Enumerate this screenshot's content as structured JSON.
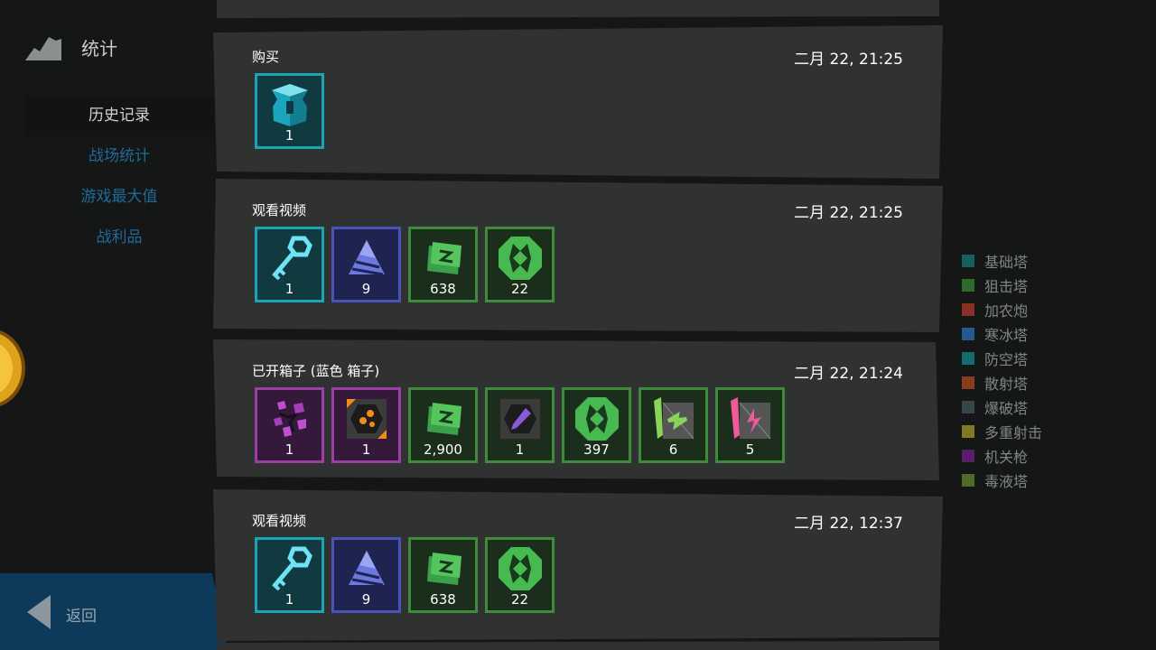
{
  "sidebar": {
    "title": "统计",
    "nav": [
      {
        "label": "历史记录",
        "active": true
      },
      {
        "label": "战场统计",
        "active": false
      },
      {
        "label": "游戏最大值",
        "active": false
      },
      {
        "label": "战利品",
        "active": false
      }
    ],
    "back_label": "返回"
  },
  "history": [
    {
      "title": "购买",
      "time": "二月 22, 21:25",
      "items": [
        {
          "icon": "blue-chest-icon",
          "qty": "1",
          "frame": "cyan"
        }
      ]
    },
    {
      "title": "观看视频",
      "time": "二月 22, 21:25",
      "items": [
        {
          "icon": "key-icon",
          "qty": "1",
          "frame": "cyan"
        },
        {
          "icon": "tile-pyramid-icon",
          "qty": "9",
          "frame": "indigo"
        },
        {
          "icon": "scroll-icon",
          "qty": "638",
          "frame": "green"
        },
        {
          "icon": "green-coin-icon",
          "qty": "22",
          "frame": "green"
        }
      ]
    },
    {
      "title": "已开箱子 (蓝色 箱子)",
      "time": "二月 22, 21:24",
      "items": [
        {
          "icon": "purple-crystals-icon",
          "qty": "1",
          "frame": "purple"
        },
        {
          "icon": "orange-module-icon",
          "qty": "1",
          "frame": "purple"
        },
        {
          "icon": "scroll-icon",
          "qty": "2,900",
          "frame": "green"
        },
        {
          "icon": "purple-module-icon",
          "qty": "1",
          "frame": "green"
        },
        {
          "icon": "green-coin-icon",
          "qty": "397",
          "frame": "green"
        },
        {
          "icon": "green-banner-icon",
          "qty": "6",
          "frame": "green"
        },
        {
          "icon": "pink-banner-icon",
          "qty": "5",
          "frame": "green"
        }
      ]
    },
    {
      "title": "观看视频",
      "time": "二月 22, 12:37",
      "items": [
        {
          "icon": "key-icon",
          "qty": "1",
          "frame": "cyan"
        },
        {
          "icon": "tile-pyramid-icon",
          "qty": "9",
          "frame": "indigo"
        },
        {
          "icon": "scroll-icon",
          "qty": "638",
          "frame": "green"
        },
        {
          "icon": "green-coin-icon",
          "qty": "22",
          "frame": "green"
        }
      ]
    }
  ],
  "legend": [
    {
      "label": "基础塔",
      "color": "#15605a"
    },
    {
      "label": "狙击塔",
      "color": "#2e6a2e"
    },
    {
      "label": "加农炮",
      "color": "#8a2f25"
    },
    {
      "label": "寒冰塔",
      "color": "#245b8e"
    },
    {
      "label": "防空塔",
      "color": "#136b73"
    },
    {
      "label": "散射塔",
      "color": "#8a3a20"
    },
    {
      "label": "爆破塔",
      "color": "#364548"
    },
    {
      "label": "多重射击",
      "color": "#7f7a25"
    },
    {
      "label": "机关枪",
      "color": "#5b1f6a"
    },
    {
      "label": "毒液塔",
      "color": "#4f6a28"
    }
  ],
  "colors": {
    "accent_blue": "#1f6a99",
    "back_panel": "#0d3a5a",
    "card_bg": "#303131",
    "page_bg": "#151717"
  }
}
